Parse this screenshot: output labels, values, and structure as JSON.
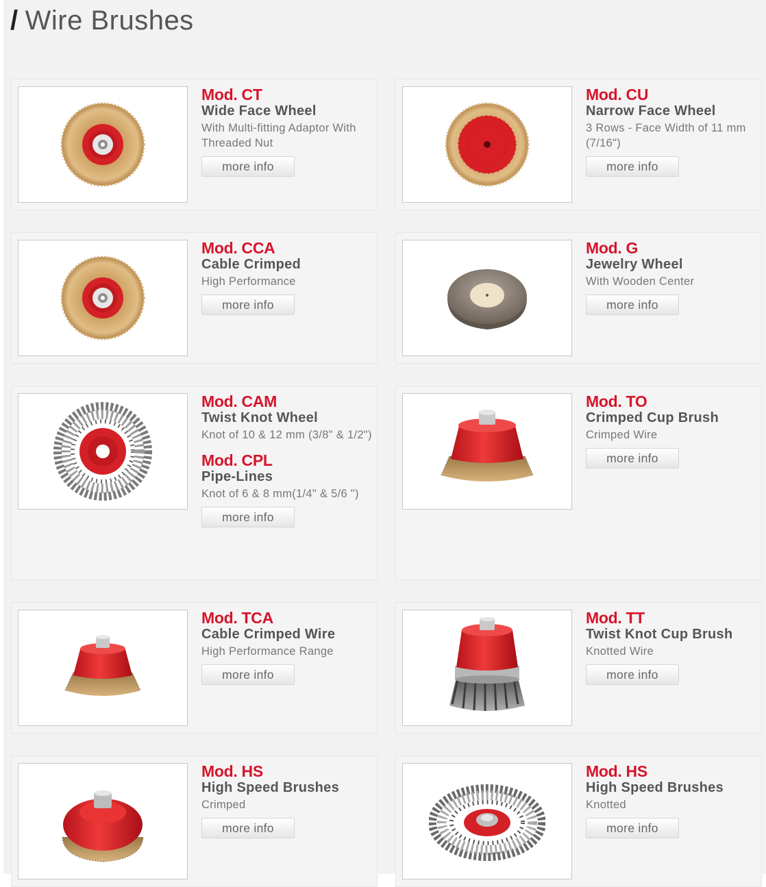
{
  "page": {
    "title": "Wire Brushes",
    "title_prefix": "/"
  },
  "colors": {
    "accent_red": "#d6142b",
    "heading_gray": "#555555",
    "text_gray": "#777777",
    "background": "#f2f2f2"
  },
  "products": [
    {
      "model": "Mod. CT",
      "name": "Wide Face Wheel",
      "desc": "With Multi-fitting Adaptor With Threaded Nut",
      "button": "more info",
      "image": "brass-wheel-brush-icon"
    },
    {
      "model": "Mod. CU",
      "name": "Narrow Face Wheel",
      "desc": "3 Rows - Face Width of 11 mm (7/16\")",
      "button": "more info",
      "image": "narrow-brass-wheel-icon"
    },
    {
      "model": "Mod. CCA",
      "name": "Cable Crimped",
      "desc": "High Performance",
      "button": "more info",
      "image": "brass-wheel-brush-icon"
    },
    {
      "model": "Mod. G",
      "name": "Jewelry Wheel",
      "desc": "With Wooden Center",
      "button": "more info",
      "image": "jewelry-wheel-icon"
    },
    {
      "model": "Mod. CAM",
      "name": "Twist Knot Wheel",
      "desc": "Knot of 10 & 12 mm (3/8\" & 1/2\")",
      "button": "more info",
      "image": "twist-knot-wheel-icon",
      "sub": {
        "model": "Mod. CPL",
        "name": "Pipe-Lines",
        "desc": "Knot of 6 & 8 mm(1/4\" & 5/6 \")"
      }
    },
    {
      "model": "Mod. TO",
      "name": "Crimped Cup Brush",
      "desc": "Crimped Wire",
      "button": "more info",
      "image": "crimped-cup-brush-icon"
    },
    {
      "model": "Mod. TCA",
      "name": "Cable Crimped Wire",
      "desc": "High Performance Range",
      "button": "more info",
      "image": "small-cup-brush-icon"
    },
    {
      "model": "Mod. TT",
      "name": "Twist Knot Cup Brush",
      "desc": "Knotted Wire",
      "button": "more info",
      "image": "knotted-cup-brush-icon"
    },
    {
      "model": "Mod. HS",
      "name": "High Speed Brushes",
      "desc": "Crimped",
      "button": "more info",
      "image": "high-speed-cup-brush-icon"
    },
    {
      "model": "Mod. HS",
      "name": "High Speed Brushes",
      "desc": "Knotted",
      "button": "more info",
      "image": "high-speed-knot-wheel-icon"
    }
  ]
}
